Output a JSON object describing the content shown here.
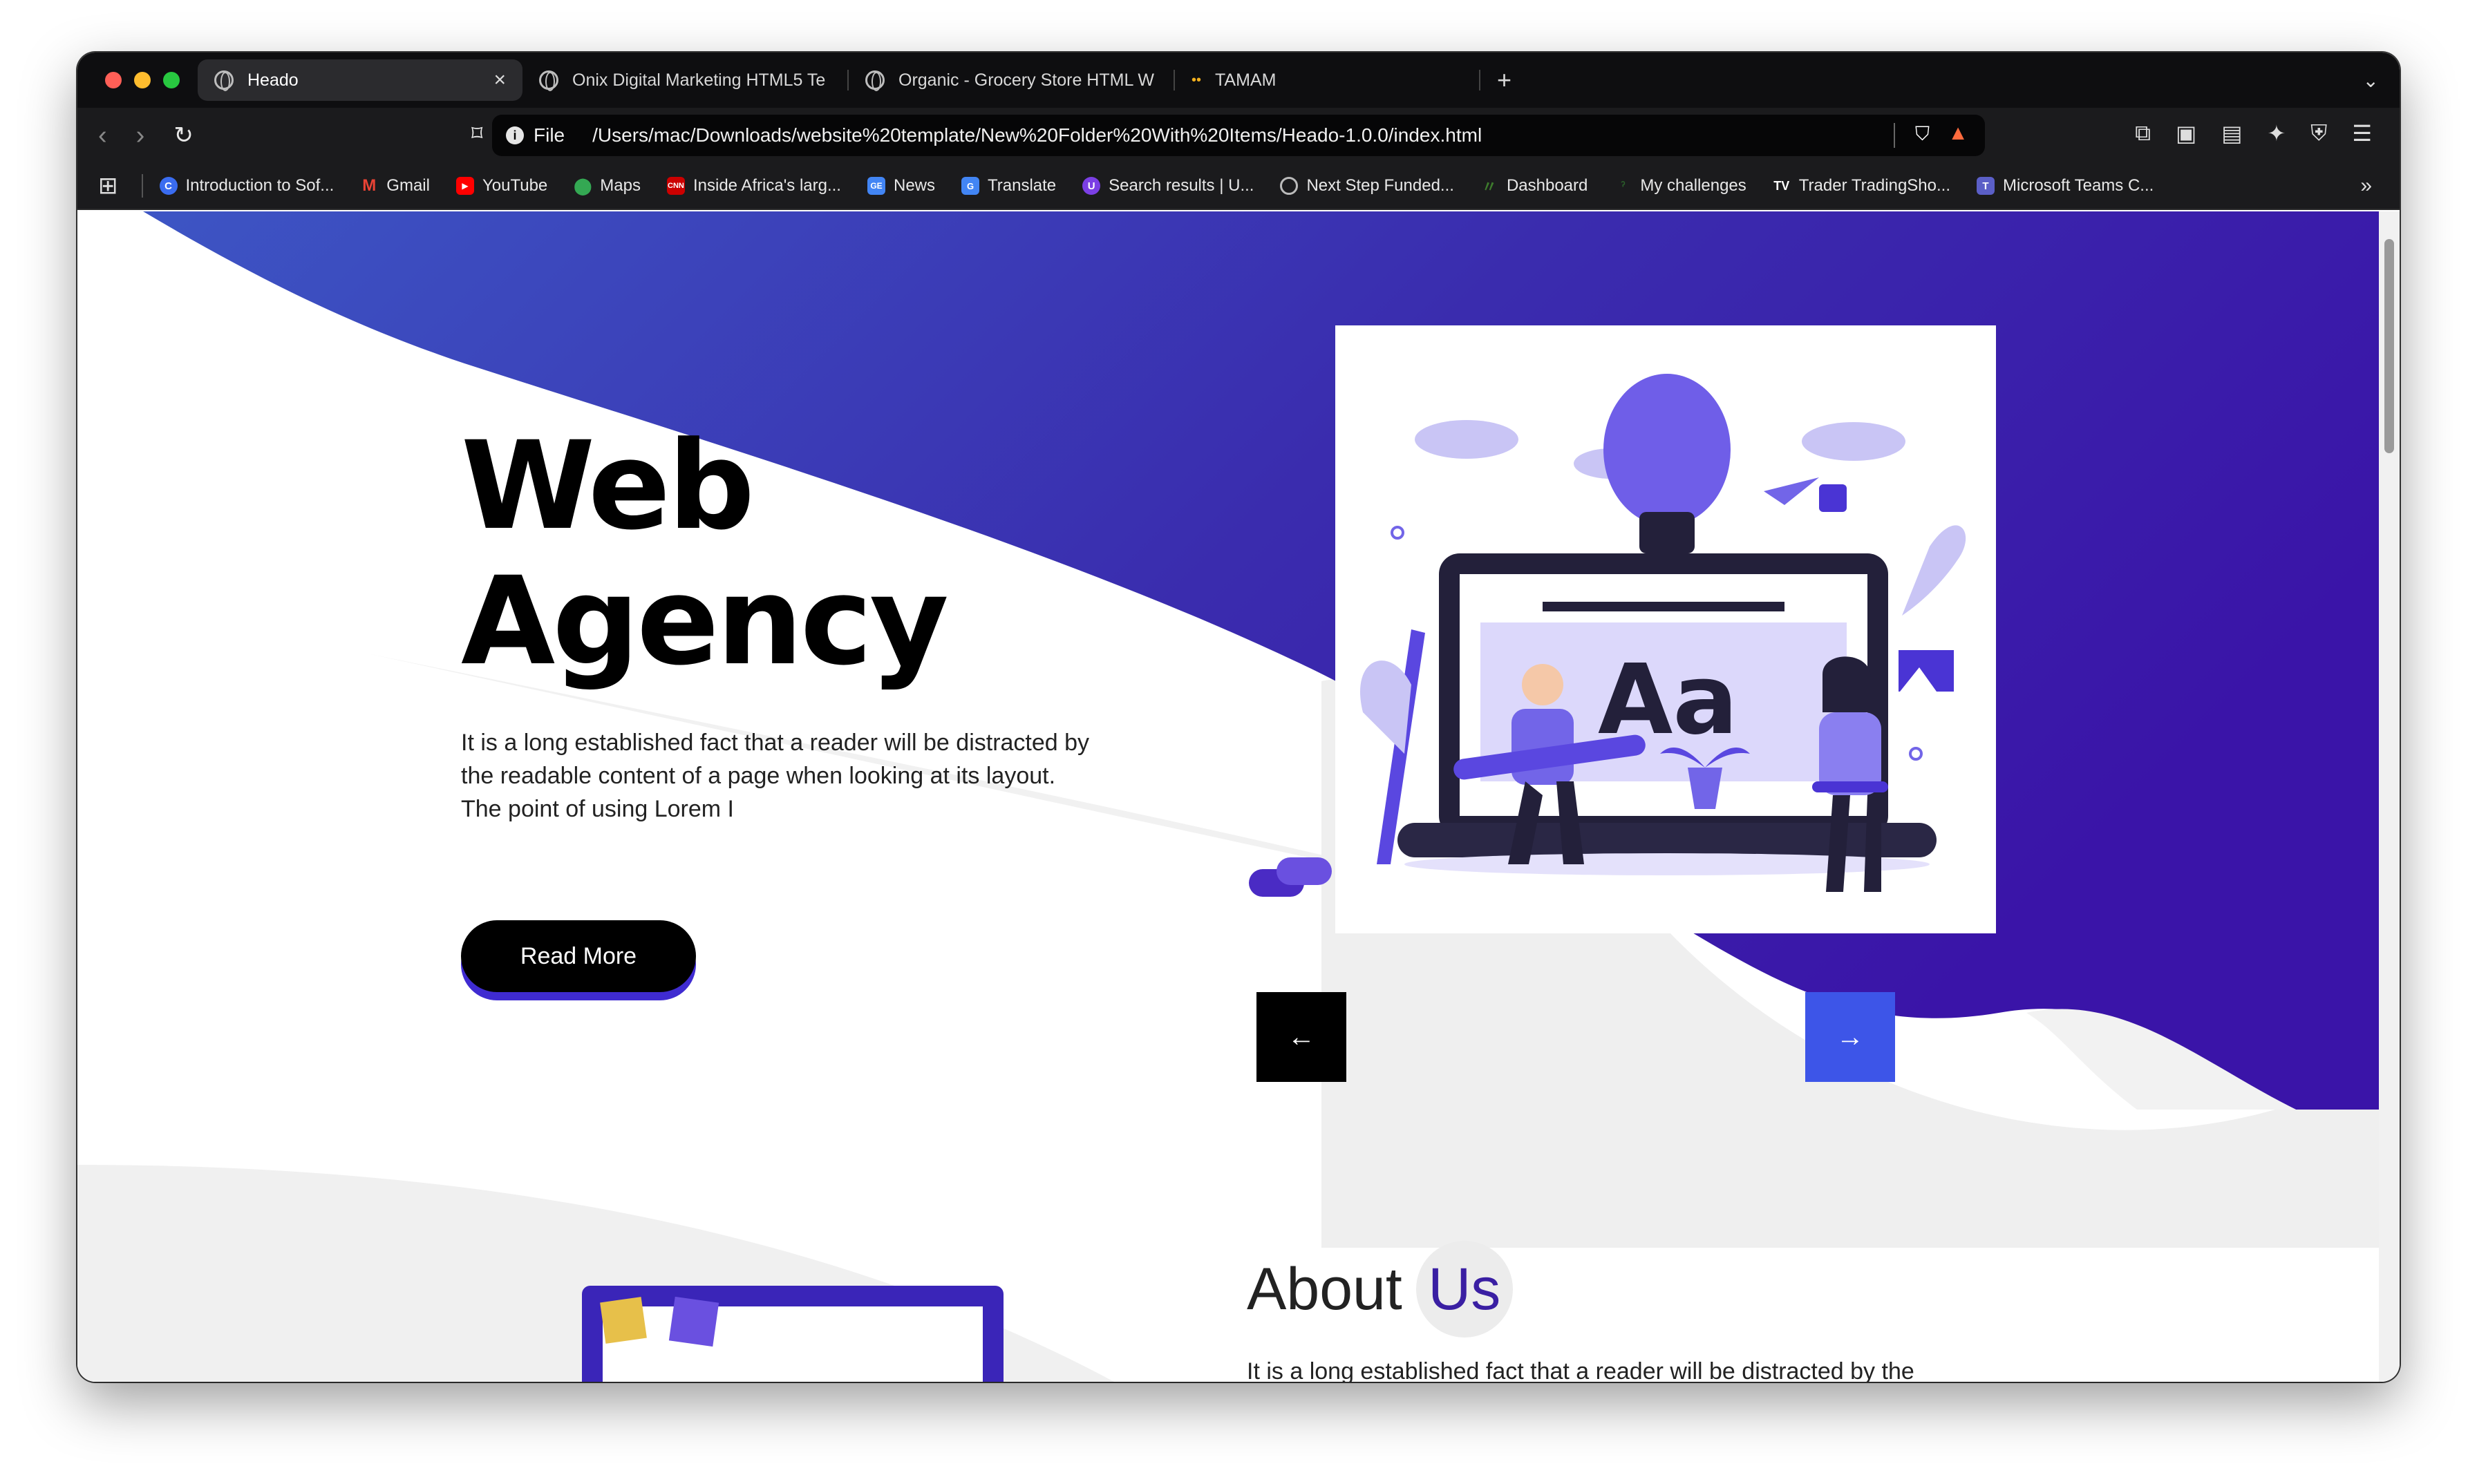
{
  "browser": {
    "tabs": [
      {
        "label": "Heado",
        "active": true
      },
      {
        "label": "Onix Digital Marketing HTML5 Te",
        "active": false
      },
      {
        "label": "Organic - Grocery Store HTML W",
        "active": false
      },
      {
        "label": "TAMAM",
        "active": false
      }
    ],
    "new_tab": "+",
    "url_scheme": "File",
    "url": "/Users/mac/Downloads/website%20template/New%20Folder%20With%20Items/Heado-1.0.0/index.html",
    "bookmarks": [
      {
        "label": "Introduction to Sof...",
        "color": "#3a6cf0"
      },
      {
        "label": "Gmail",
        "color": "#ea4335"
      },
      {
        "label": "YouTube",
        "color": "#ff0000"
      },
      {
        "label": "Maps",
        "color": "#34a853"
      },
      {
        "label": "Inside Africa's larg...",
        "color": "#cc0000"
      },
      {
        "label": "News",
        "color": "#4285f4"
      },
      {
        "label": "Translate",
        "color": "#4285f4"
      },
      {
        "label": "Search results | U...",
        "color": "#7b3fe4"
      },
      {
        "label": "Next Step Funded...",
        "color": "#555555"
      },
      {
        "label": "Dashboard",
        "color": "#3d7a2c"
      },
      {
        "label": "My challenges",
        "color": "#2a5e2a"
      },
      {
        "label": "Trader TradingSho...",
        "color": "#222222"
      },
      {
        "label": "Microsoft Teams C...",
        "color": "#5b5fc7"
      }
    ]
  },
  "hero": {
    "title_line1": "Web",
    "title_line2": "Agency",
    "text_line1": "It is a long established fact that a reader will be distracted by",
    "text_line2": "the readable content of a page when looking at its layout.",
    "text_line3": "The point of using Lorem I",
    "button": "Read More",
    "prev_arrow": "←",
    "next_arrow": "→",
    "illustration_text": "Aa"
  },
  "about": {
    "title": "About",
    "highlight": "Us",
    "text": "It is a long established fact that a reader will be distracted by the"
  },
  "colors": {
    "accent": "#3f2bd1",
    "gradient_start": "#3d54c5",
    "gradient_end": "#3a14a8",
    "next_button": "#3d55e8"
  }
}
